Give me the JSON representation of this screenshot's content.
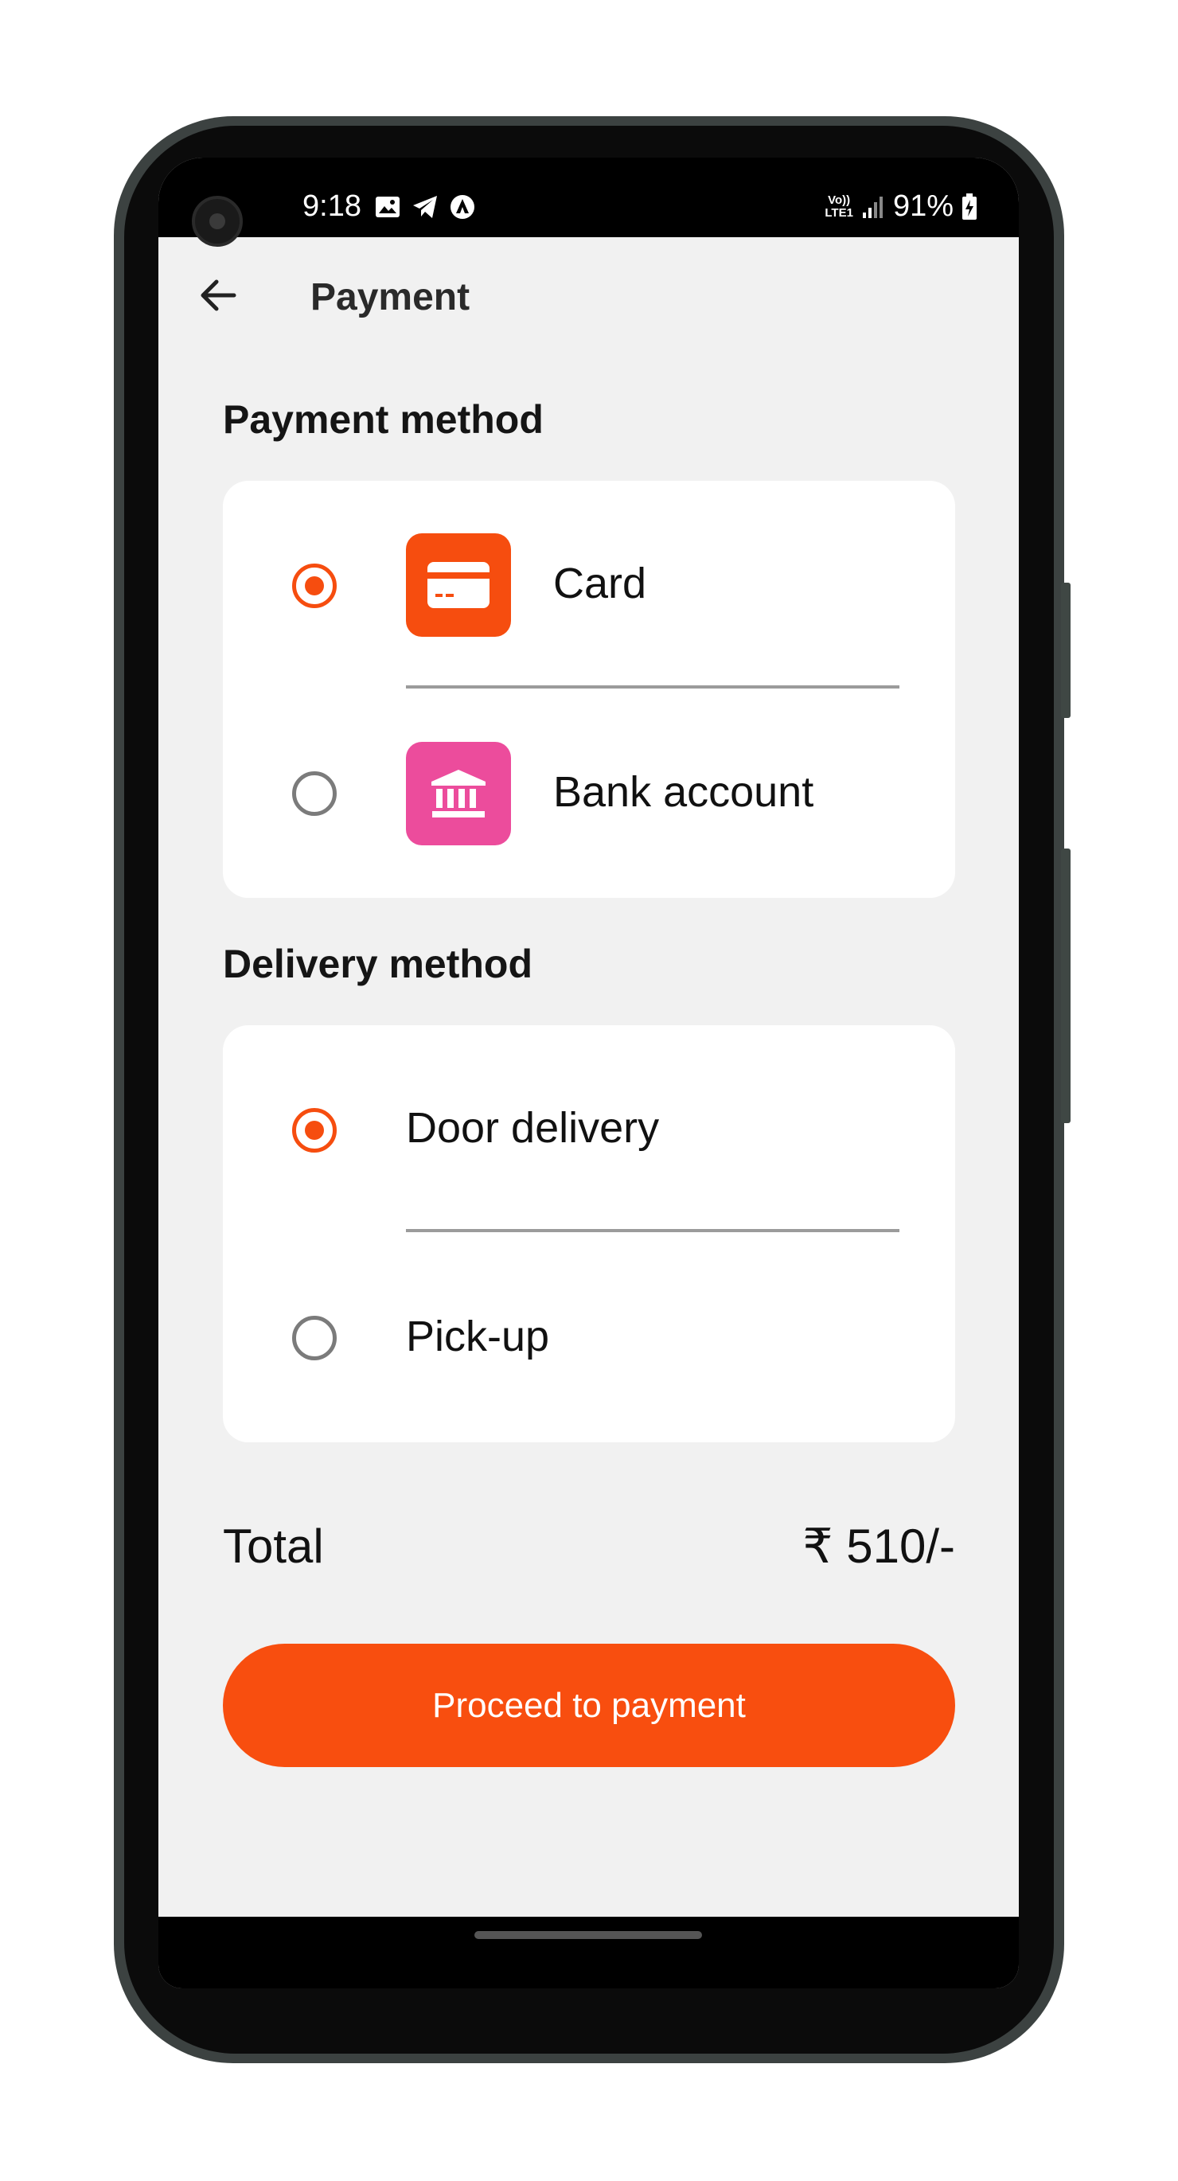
{
  "status_bar": {
    "time": "9:18",
    "network_label_top": "Vo))",
    "network_label_bottom": "LTE1",
    "battery": "91%"
  },
  "app_bar": {
    "title": "Payment",
    "back_icon": "arrow-left-icon"
  },
  "payment_section": {
    "title": "Payment method",
    "options": [
      {
        "label": "Card",
        "icon": "credit-card-icon",
        "icon_color": "#f64d0f",
        "selected": true
      },
      {
        "label": "Bank account",
        "icon": "bank-icon",
        "icon_color": "#ec4c9c",
        "selected": false
      }
    ]
  },
  "delivery_section": {
    "title": "Delivery method",
    "options": [
      {
        "label": "Door delivery",
        "selected": true
      },
      {
        "label": "Pick-up",
        "selected": false
      }
    ]
  },
  "total": {
    "label": "Total",
    "value": "₹ 510/-"
  },
  "proceed_button": {
    "label": "Proceed to payment"
  },
  "colors": {
    "accent": "#f84e0f",
    "background": "#f1f1f1",
    "card": "#ffffff"
  }
}
